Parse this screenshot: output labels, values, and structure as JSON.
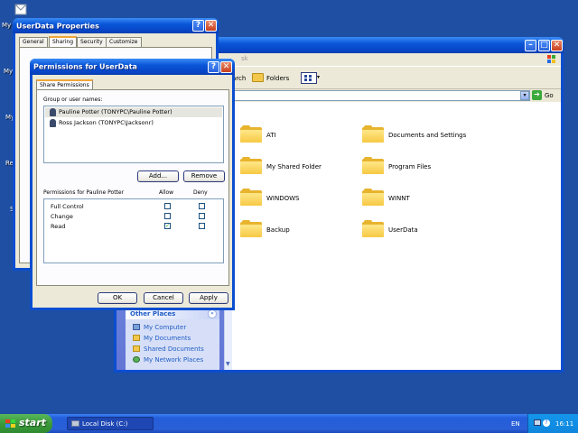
{
  "desktop": {
    "labels": [
      "My",
      "My",
      "My",
      "Re",
      "S"
    ]
  },
  "userdata_props": {
    "title": "UserData Properties",
    "tabs": [
      "General",
      "Sharing",
      "Security",
      "Customize"
    ]
  },
  "permissions": {
    "title": "Permissions for UserData",
    "tab": "Share Permissions",
    "group_label": "Group or user names:",
    "users": [
      "Pauline Potter (TONYPC\\Pauline Potter)",
      "Ross Jackson (TONYPC\\Jacksonr)"
    ],
    "add_label": "Add...",
    "remove_label": "Remove",
    "perms_for": "Permissions for Pauline Potter",
    "allow_label": "Allow",
    "deny_label": "Deny",
    "rows": [
      {
        "name": "Full Control",
        "allow": false,
        "deny": false
      },
      {
        "name": "Change",
        "allow": false,
        "deny": false
      },
      {
        "name": "Read",
        "allow": true,
        "deny": false
      }
    ],
    "ok_label": "OK",
    "cancel_label": "Cancel",
    "apply_label": "Apply"
  },
  "explorer": {
    "toolbar_search": "arch",
    "toolbar_folders": "Folders",
    "go_label": "Go",
    "title_fragment": "sk",
    "folders": [
      "ATI",
      "Documents and Settings",
      "My Shared Folder",
      "Program Files",
      "WINDOWS",
      "WINNT",
      "Backup",
      "UserData"
    ],
    "other_places_title": "Other Places",
    "other_places": [
      "My Computer",
      "My Documents",
      "Shared Documents",
      "My Network Places"
    ]
  },
  "taskbar": {
    "start_label": "start",
    "task_label": "Local Disk (C:)",
    "lang": "EN",
    "time": "16:11"
  }
}
